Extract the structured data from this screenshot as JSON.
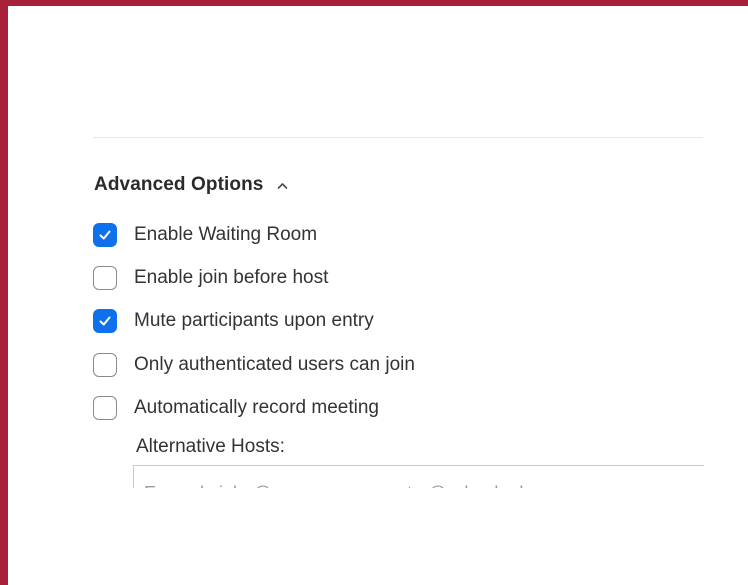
{
  "colors": {
    "accent": "#0e71eb",
    "frame": "#a8203a"
  },
  "advanced_options": {
    "title": "Advanced Options",
    "toggle_icon": "chevron-up-icon",
    "items": [
      {
        "label": "Enable Waiting Room",
        "checked": true
      },
      {
        "label": "Enable join before host",
        "checked": false
      },
      {
        "label": "Mute participants upon entry",
        "checked": true
      },
      {
        "label": "Only authenticated users can join",
        "checked": false
      },
      {
        "label": "Automatically record meeting",
        "checked": false
      }
    ]
  },
  "alternative_hosts": {
    "label": "Alternative Hosts:",
    "placeholder": "Example:john@company.com;peter@school.edu",
    "value": ""
  }
}
